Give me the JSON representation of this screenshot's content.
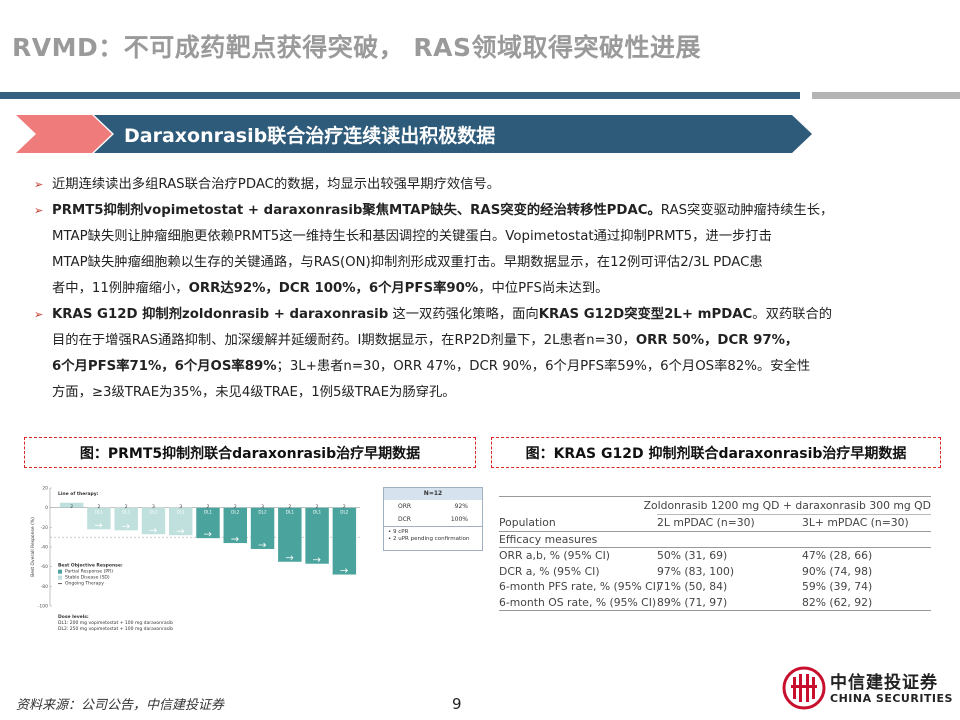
{
  "header": {
    "title": "RVMD：不可成药靶点获得突破， RAS领域取得突破性进展",
    "rule_color": "#34617f"
  },
  "section": {
    "title": "Daraxonrasib联合治疗连续读出积极数据",
    "bar_color": "#2f5b7a",
    "accent_color": "#f07b7b"
  },
  "bullets": [
    {
      "lines": [
        "近期连续读出多组RAS联合治疗PDAC的数据，均显示出较强早期疗效信号。"
      ]
    },
    {
      "lines": [
        [
          {
            "t": "PRMT5抑制剂vopimetostat + daraxonrasib聚焦MTAP缺失、RAS突变的经治转移性PDAC。",
            "b": true
          },
          {
            "t": "RAS突变驱动肿瘤持续生长，",
            "b": false
          }
        ],
        [
          {
            "t": "MTAP缺失则让肿瘤细胞更依赖PRMT5这一维持生长和基因调控的关键蛋白。Vopimetostat通过抑制PRMT5，进一步打击",
            "b": false
          }
        ],
        [
          {
            "t": "MTAP缺失肿瘤细胞赖以生存的关键通路，与RAS(ON)抑制剂形成双重打击。早期数据显示，在12例可评估2/3L PDAC患",
            "b": false
          }
        ],
        [
          {
            "t": "者中，11例肿瘤缩小，",
            "b": false
          },
          {
            "t": "ORR达92%，DCR 100%，6个月PFS率90%",
            "b": true
          },
          {
            "t": "，中位PFS尚未达到。",
            "b": false
          }
        ]
      ]
    },
    {
      "lines": [
        [
          {
            "t": "KRAS G12D 抑制剂zoldonrasib + daraxonrasib",
            "b": true
          },
          {
            "t": " 这一双药强化策略，面向",
            "b": false
          },
          {
            "t": "KRAS G12D突变型2L+ mPDAC",
            "b": true
          },
          {
            "t": "。双药联合的",
            "b": false
          }
        ],
        [
          {
            "t": "目的在于增强RAS通路抑制、加深缓解并延缓耐药。I期数据显示，在RP2D剂量下，2L患者n=30，",
            "b": false
          },
          {
            "t": "ORR 50%，DCR 97%，",
            "b": true
          }
        ],
        [
          {
            "t": "6个月PFS率71%，6个月OS率89%",
            "b": true
          },
          {
            "t": "；3L+患者n=30，ORR 47%，DCR 90%，6个月PFS率59%，6个月OS率82%。安全性",
            "b": false
          }
        ],
        [
          {
            "t": "方面，≥3级TRAE为35%，未见4级TRAE，1例5级TRAE为肠穿孔。",
            "b": false
          }
        ]
      ]
    }
  ],
  "figures": {
    "left_caption": "图：PRMT5抑制剂联合daraxonrasib治疗早期数据",
    "right_caption": "图：KRAS G12D 抑制剂联合daraxonrasib治疗早期数据",
    "border_color": "#d62828"
  },
  "chart_data": {
    "type": "bar",
    "ylabel": "Best Overall Response (%)",
    "ylim": [
      -100,
      20
    ],
    "yticks": [
      20,
      0,
      -20,
      -40,
      -60,
      -80,
      -100
    ],
    "bar_color": "#4aa39c",
    "stable_color": "#bfe0dc",
    "line_of_therapy_label": "Line of therapy:",
    "line_of_therapy": [
      "2",
      "2",
      "2",
      "3",
      "3",
      "2",
      "2",
      "3",
      "2",
      "2",
      "2"
    ],
    "dose_labels": [
      "DL1",
      "DL1",
      "DL1",
      "DL1",
      "DL1",
      "DL1",
      "DL2",
      "DL2",
      "DL1",
      "DL1",
      "DL2"
    ],
    "values": [
      5,
      -22,
      -23,
      -27,
      -28,
      -31,
      -36,
      -42,
      -55,
      -57,
      -68
    ],
    "legend_title": "Best Objective Response:",
    "legend": [
      "Partial Response (PR)",
      "Stable Disease (SD)",
      "Ongoing Therapy"
    ],
    "dose_levels_title": "Dose levels:",
    "dose_levels": [
      "DL1: 200 mg vopimetostat + 100 mg daraxonrasib",
      "DL2: 250 mg vopimetostat + 100 mg daraxonrasib"
    ]
  },
  "summary_box": {
    "header": "N=12",
    "rows": [
      {
        "label": "ORR",
        "value": "92%"
      },
      {
        "label": "DCR",
        "value": "100%"
      }
    ],
    "notes": [
      "• 9 cPR",
      "• 2 uPR pending confirmation"
    ]
  },
  "kras_table": {
    "header_row1": [
      "",
      "Zoldonrasib 1200 mg QD + daraxonrasib 300 mg QD"
    ],
    "population_label": "Population",
    "header_row2": [
      "2L mPDAC (n=30)",
      "3L+ mPDAC (n=30)"
    ],
    "efficacy_label": "Efficacy measures",
    "rows": [
      [
        "ORR a,b, % (95% CI)",
        "50% (31, 69)",
        "47% (28, 66)"
      ],
      [
        "DCR a, % (95% CI)",
        "97% (83, 100)",
        "90% (74, 98)"
      ],
      [
        "6-month PFS rate, % (95% CI)",
        "71% (50, 84)",
        "59% (39, 74)"
      ],
      [
        "6-month OS rate, % (95% CI)",
        "89% (71, 97)",
        "82% (62, 92)"
      ]
    ]
  },
  "footer": {
    "source": "资料来源：公司公告，中信建投证券",
    "page_number": "9",
    "logo_cn": "中信建投证券",
    "logo_en": "CHINA SECURITIES",
    "logo_color": "#c8102e"
  }
}
